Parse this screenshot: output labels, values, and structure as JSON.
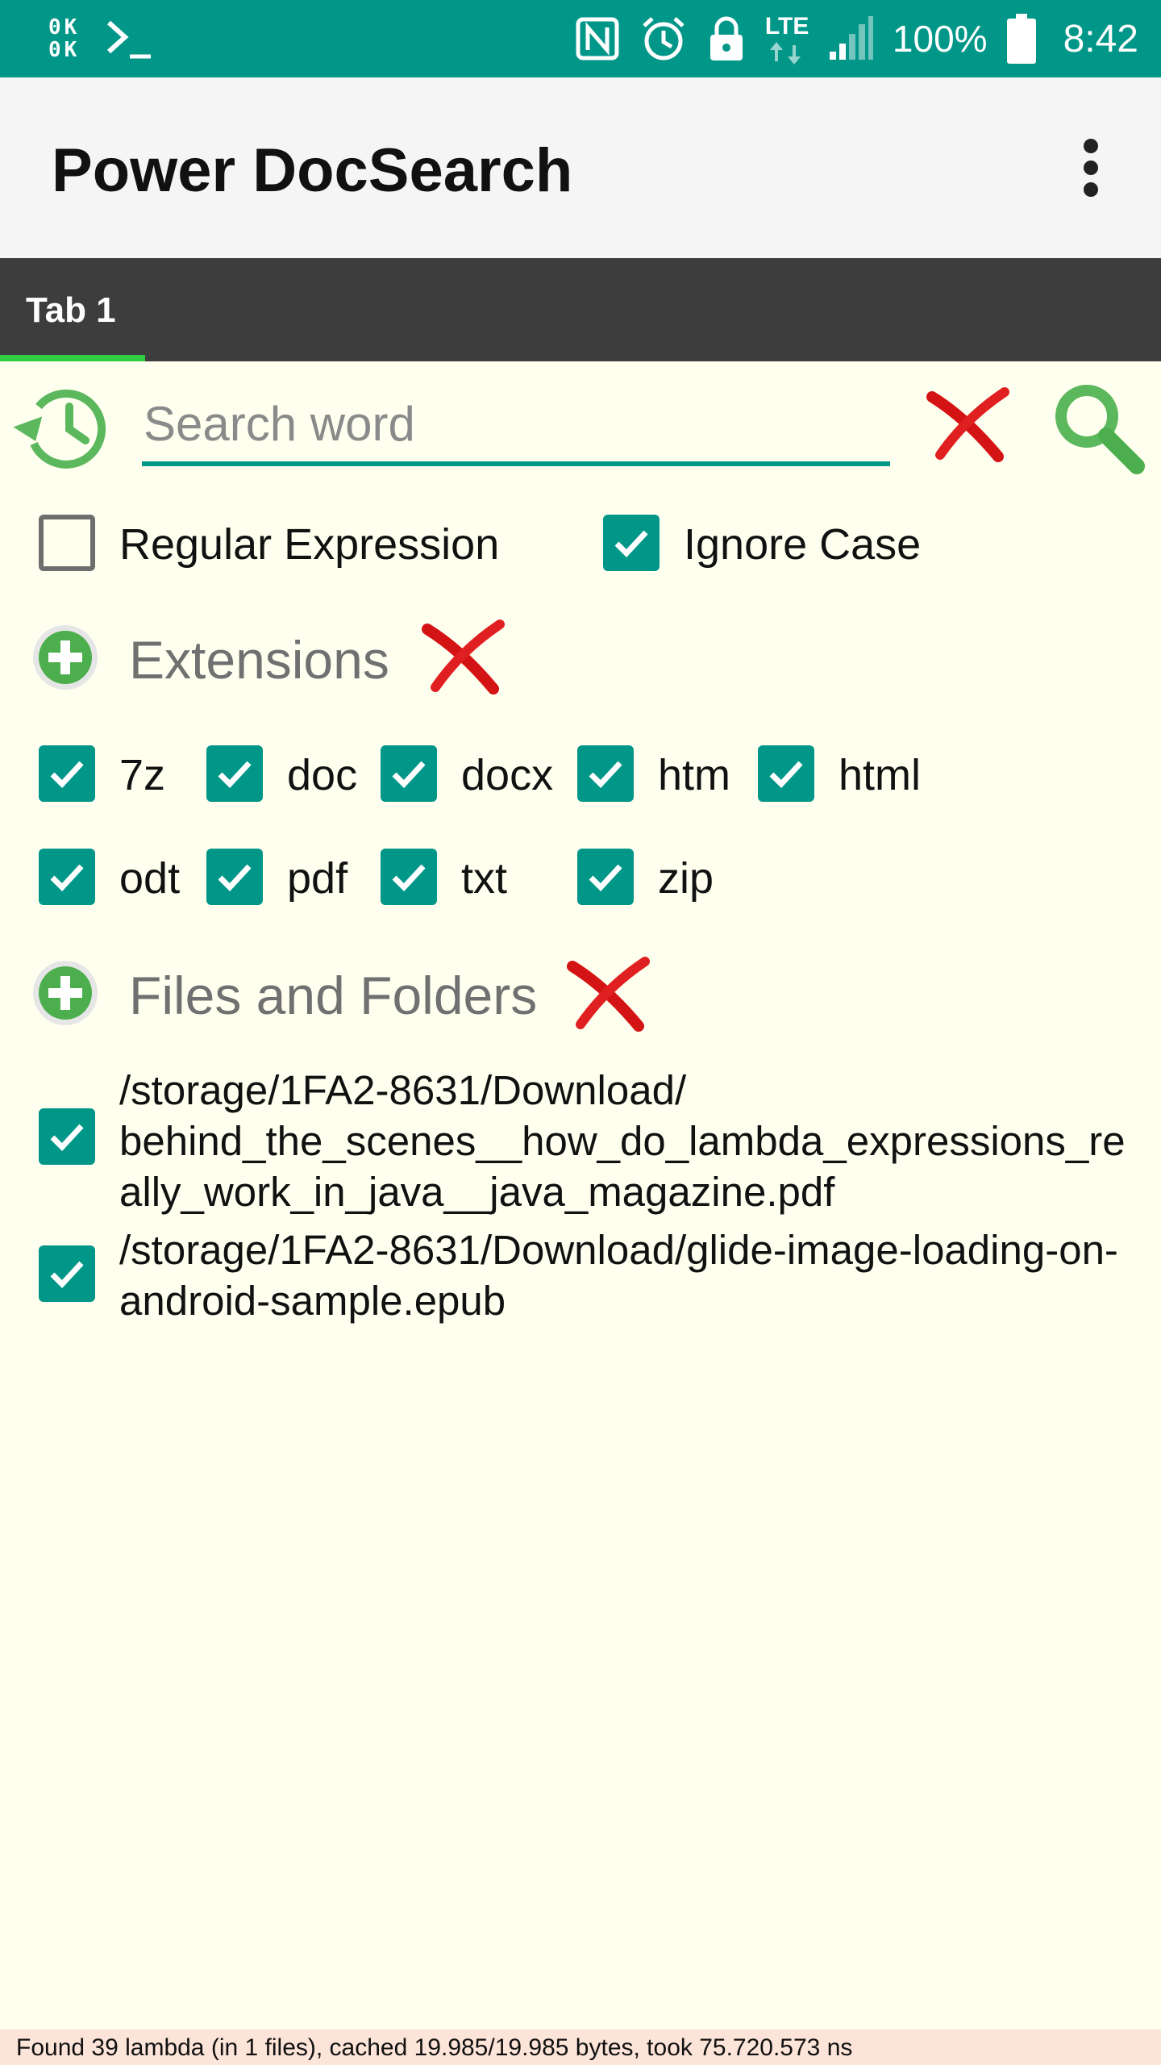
{
  "status_bar": {
    "left_text": "0K\n0K",
    "battery_percent": "100%",
    "time": "8:42",
    "network": "LTE",
    "icons": [
      "okok-icon",
      "terminal-icon",
      "nfc-icon",
      "alarm-icon",
      "lock-icon",
      "lte-icon",
      "signal-icon",
      "battery-icon"
    ]
  },
  "app_bar": {
    "title": "Power DocSearch",
    "menu_icon": "overflow-menu-icon"
  },
  "tabs": [
    {
      "label": "Tab 1",
      "selected": true
    }
  ],
  "search": {
    "value": "",
    "placeholder": "Search word",
    "history_icon": "history-icon",
    "clear_icon": "clear-x-icon",
    "search_icon": "search-icon"
  },
  "options": {
    "regex": {
      "label": "Regular Expression",
      "checked": false
    },
    "ignore_case": {
      "label": "Ignore Case",
      "checked": true
    }
  },
  "extensions": {
    "title": "Extensions",
    "items": [
      {
        "label": "7z",
        "checked": true
      },
      {
        "label": "doc",
        "checked": true
      },
      {
        "label": "docx",
        "checked": true
      },
      {
        "label": "htm",
        "checked": true
      },
      {
        "label": "html",
        "checked": true
      },
      {
        "label": "odt",
        "checked": true
      },
      {
        "label": "pdf",
        "checked": true
      },
      {
        "label": "txt",
        "checked": true
      },
      {
        "label": "zip",
        "checked": true
      }
    ]
  },
  "files": {
    "title": "Files and Folders",
    "items": [
      {
        "path": "/storage/1FA2-8631/Download/\nbehind_the_scenes__how_do_lambda_expressions_really_work_in_java__java_magazine.pdf",
        "checked": true
      },
      {
        "path": "/storage/1FA2-8631/Download/glide-image-loading-on-android-sample.epub",
        "checked": true
      }
    ]
  },
  "footer": {
    "status": "Found 39 lambda (in 1 files), cached 19.985/19.985 bytes, took 75.720.573 ns"
  },
  "colors": {
    "status_bar": "#009688",
    "accent": "#009688",
    "tab_bar": "#3d3d3d",
    "tab_indicator": "#2ecc40",
    "background": "#fffff0",
    "footer": "#fde4d8"
  }
}
